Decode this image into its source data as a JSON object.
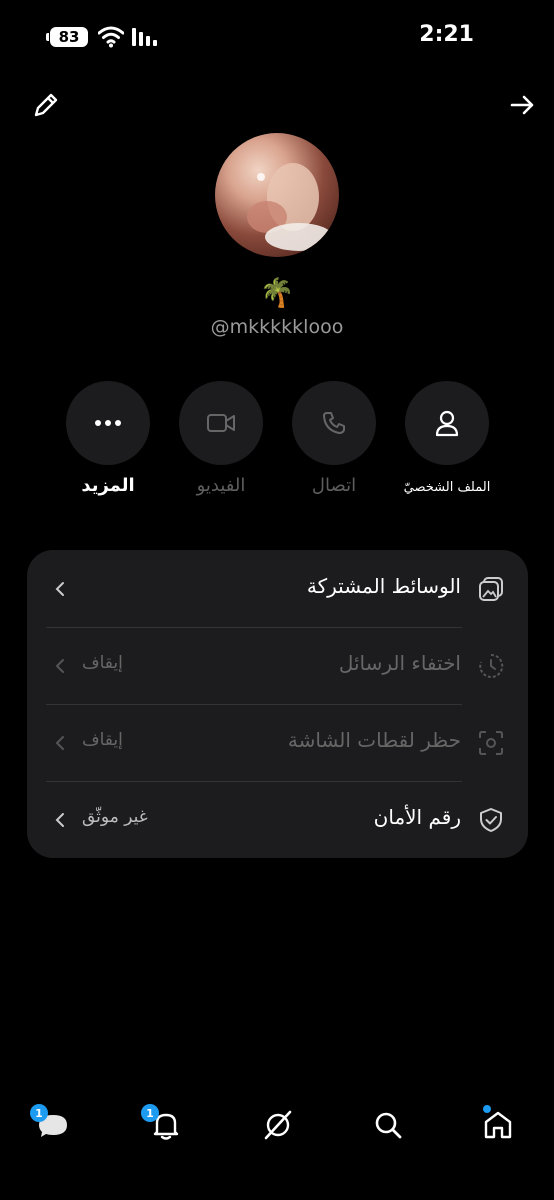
{
  "status_bar": {
    "battery": "83",
    "time": "2:21"
  },
  "profile": {
    "emoji": "🌴",
    "username": "@mkkkkklooo"
  },
  "actions": [
    {
      "label": "المزيد",
      "icon": "more-icon"
    },
    {
      "label": "الفيديو",
      "icon": "video-icon"
    },
    {
      "label": "اتصال",
      "icon": "phone-icon"
    },
    {
      "label": "الملف الشخصيّ",
      "icon": "profile-icon"
    }
  ],
  "settings": [
    {
      "title": "الوسائط المشتركة",
      "value": "",
      "icon": "media-icon"
    },
    {
      "title": "اختفاء الرسائل",
      "value": "إيقاف",
      "icon": "timer-icon"
    },
    {
      "title": "حظر لقطات الشاشة",
      "value": "إيقاف",
      "icon": "screenshot-icon"
    },
    {
      "title": "رقم الأمان",
      "value": "غير موثّق",
      "icon": "shield-icon"
    }
  ],
  "nav": {
    "messages_badge": "1",
    "notifications_badge": "1"
  },
  "colors": {
    "accent": "#1d9bf0",
    "card": "#1c1c1e",
    "background": "#000000"
  }
}
